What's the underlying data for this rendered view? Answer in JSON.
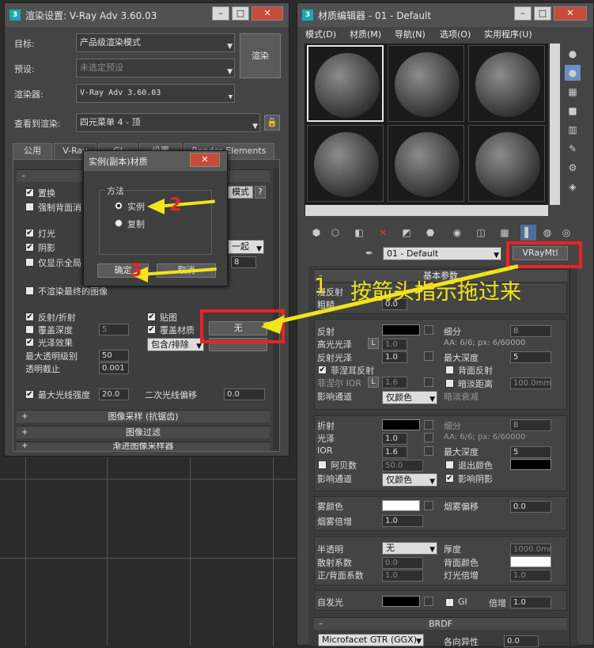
{
  "render": {
    "title": "渲染设置: V-Ray Adv 3.60.03",
    "target_label": "目标:",
    "target_value": "产品级渲染模式",
    "preset_label": "预设:",
    "preset_value": "未选定预设",
    "renderer_label": "渲染器:",
    "renderer_value": "V-Ray Adv 3.60.03",
    "view_label": "查看到渲染:",
    "view_value": "四元菜单 4 - 顶",
    "render_btn": "渲染",
    "tabs": [
      "公用",
      "V-Ray",
      "GI",
      "设置",
      "Render Elements"
    ],
    "s_replace": "置换",
    "s_force_back": "强制背面消",
    "mode_btn": "模式",
    "q_btn": "?",
    "s_lights": "灯光",
    "s_shadows": "阴影",
    "s_only_gi": "仅显示全局",
    "together": "一起",
    "spin8": "8",
    "s_no_final": "不渲染最终的图像",
    "s_refl": "反射/折射",
    "s_maps": "贴图",
    "s_depth": "覆盖深度",
    "s_depth_val": "5",
    "s_override": "覆盖材质",
    "none_btn": "无",
    "s_gloss": "光泽效果",
    "s_include": "包含/排除",
    "s_max_transp": "最大透明级别",
    "s_max_transp_val": "50",
    "s_transp_cut": "透明截止",
    "s_transp_cut_val": "0.001",
    "s_max_ray": "最大光线强度",
    "s_max_ray_val": "20.0",
    "s_sec_ray": "二次光线偏移",
    "s_sec_ray_val": "0.0",
    "rollouts": [
      "图像采样 (抗锯齿)",
      "图像过滤",
      "渐进图像采样器"
    ]
  },
  "dialog": {
    "title": "实例(副本)材质",
    "group": "方法",
    "opt1": "实例",
    "opt2": "复制",
    "ok": "确定",
    "cancel": "取消"
  },
  "annot": {
    "n1": "1",
    "t1": "按箭头指示拖过来",
    "n2": "2",
    "n3": "3"
  },
  "mat": {
    "title": "材质编辑器 - 01 - Default",
    "menu": [
      "模式(D)",
      "材质(M)",
      "导航(N)",
      "选项(O)",
      "实用程序(U)"
    ],
    "name": "01 - Default",
    "type_btn": "VRayMtl",
    "basic": "基本参数",
    "diffuse": "漫反射",
    "rough": "粗糙",
    "rough_val": "0.0",
    "reflect": "反射",
    "subdiv": "细分",
    "subdiv_val": "8",
    "hilight": "高光光泽",
    "L": "L",
    "hl_val": "1.0",
    "aa": "AA: 6/6; px: 6/60000",
    "refl_gloss": "反射光泽",
    "refl_gloss_val": "1.0",
    "max_depth": "最大深度",
    "max_depth_val": "5",
    "fresnel": "菲涅耳反射",
    "back_refl": "背面反射",
    "fresnel_ior": "菲涅尔 IOR",
    "fresnel_ior_val": "1.6",
    "dim_dist": "暗淡距离",
    "dim_val": "100.0mm",
    "affect_ch": "影响通道",
    "ch_val": "仅颜色",
    "dim_falloff": "暗淡衰减",
    "refract": "折射",
    "r_subdiv_val": "8",
    "gloss": "光泽",
    "r_gloss_val": "1.0",
    "r_aa": "AA: 6/6; px: 6/60000",
    "ior": "IOR",
    "ior_val": "1.6",
    "r_depth_val": "5",
    "abbe": "阿贝数",
    "abbe_val": "50.0",
    "exit_color": "退出颜色",
    "r_ch_val": "仅颜色",
    "affect_shadows": "影响阴影",
    "fog_color": "雾颜色",
    "fog_bias": "烟雾偏移",
    "fog_bias_val": "0.0",
    "fog_mult": "烟雾倍增",
    "fog_mult_val": "1.0",
    "translucency": "半透明",
    "transl_val": "无",
    "thickness": "厚度",
    "thickness_val": "1000.0mm",
    "scatter": "散射系数",
    "scatter_val": "0.0",
    "back_color": "背面颜色",
    "fb": "正/背面系数",
    "fb_val": "1.0",
    "light_mult": "灯光倍增",
    "light_mult_val": "1.0",
    "self_illum": "自发光",
    "gi": "GI",
    "mult": "倍增",
    "mult_val": "1.0",
    "brdf": "BRDF",
    "brdf_type": "Microfacet GTR (GGX)",
    "aniso": "各向异性",
    "aniso_val": "0.0"
  }
}
